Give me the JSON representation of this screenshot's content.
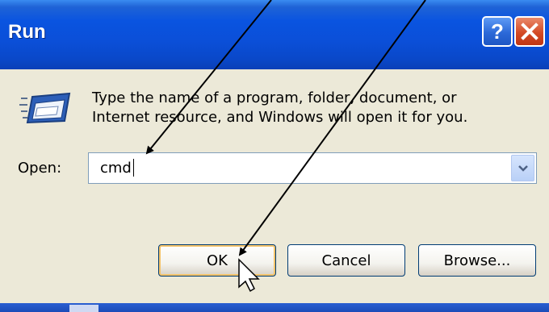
{
  "window": {
    "title": "Run",
    "help_label": "?",
    "close_icon": "close-icon"
  },
  "dialog": {
    "message_line1": "Type the name of a program, folder, document, or",
    "message_line2": "Internet resource, and Windows will open it for you.",
    "open_label": "Open:",
    "open_value": "cmd",
    "ok_label": "OK",
    "cancel_label": "Cancel",
    "browse_label": "Browse..."
  },
  "colors": {
    "titlebar": "#0a54e0",
    "dialog_bg": "#ece9d8",
    "close_button": "#d44a25",
    "help_button": "#2c69d8",
    "ok_focus_ring": "#f4c36a"
  }
}
